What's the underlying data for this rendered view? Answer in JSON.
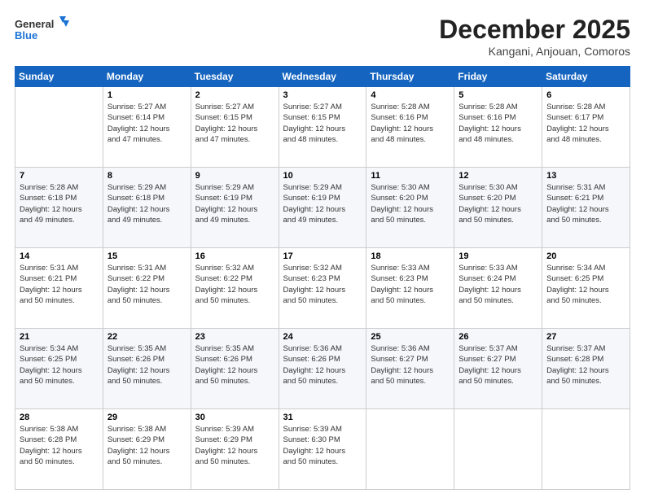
{
  "logo": {
    "line1": "General",
    "line2": "Blue"
  },
  "header": {
    "month": "December 2025",
    "location": "Kangani, Anjouan, Comoros"
  },
  "weekdays": [
    "Sunday",
    "Monday",
    "Tuesday",
    "Wednesday",
    "Thursday",
    "Friday",
    "Saturday"
  ],
  "weeks": [
    [
      {
        "day": "",
        "info": ""
      },
      {
        "day": "1",
        "info": "Sunrise: 5:27 AM\nSunset: 6:14 PM\nDaylight: 12 hours\nand 47 minutes."
      },
      {
        "day": "2",
        "info": "Sunrise: 5:27 AM\nSunset: 6:15 PM\nDaylight: 12 hours\nand 47 minutes."
      },
      {
        "day": "3",
        "info": "Sunrise: 5:27 AM\nSunset: 6:15 PM\nDaylight: 12 hours\nand 48 minutes."
      },
      {
        "day": "4",
        "info": "Sunrise: 5:28 AM\nSunset: 6:16 PM\nDaylight: 12 hours\nand 48 minutes."
      },
      {
        "day": "5",
        "info": "Sunrise: 5:28 AM\nSunset: 6:16 PM\nDaylight: 12 hours\nand 48 minutes."
      },
      {
        "day": "6",
        "info": "Sunrise: 5:28 AM\nSunset: 6:17 PM\nDaylight: 12 hours\nand 48 minutes."
      }
    ],
    [
      {
        "day": "7",
        "info": "Sunrise: 5:28 AM\nSunset: 6:18 PM\nDaylight: 12 hours\nand 49 minutes."
      },
      {
        "day": "8",
        "info": "Sunrise: 5:29 AM\nSunset: 6:18 PM\nDaylight: 12 hours\nand 49 minutes."
      },
      {
        "day": "9",
        "info": "Sunrise: 5:29 AM\nSunset: 6:19 PM\nDaylight: 12 hours\nand 49 minutes."
      },
      {
        "day": "10",
        "info": "Sunrise: 5:29 AM\nSunset: 6:19 PM\nDaylight: 12 hours\nand 49 minutes."
      },
      {
        "day": "11",
        "info": "Sunrise: 5:30 AM\nSunset: 6:20 PM\nDaylight: 12 hours\nand 50 minutes."
      },
      {
        "day": "12",
        "info": "Sunrise: 5:30 AM\nSunset: 6:20 PM\nDaylight: 12 hours\nand 50 minutes."
      },
      {
        "day": "13",
        "info": "Sunrise: 5:31 AM\nSunset: 6:21 PM\nDaylight: 12 hours\nand 50 minutes."
      }
    ],
    [
      {
        "day": "14",
        "info": "Sunrise: 5:31 AM\nSunset: 6:21 PM\nDaylight: 12 hours\nand 50 minutes."
      },
      {
        "day": "15",
        "info": "Sunrise: 5:31 AM\nSunset: 6:22 PM\nDaylight: 12 hours\nand 50 minutes."
      },
      {
        "day": "16",
        "info": "Sunrise: 5:32 AM\nSunset: 6:22 PM\nDaylight: 12 hours\nand 50 minutes."
      },
      {
        "day": "17",
        "info": "Sunrise: 5:32 AM\nSunset: 6:23 PM\nDaylight: 12 hours\nand 50 minutes."
      },
      {
        "day": "18",
        "info": "Sunrise: 5:33 AM\nSunset: 6:23 PM\nDaylight: 12 hours\nand 50 minutes."
      },
      {
        "day": "19",
        "info": "Sunrise: 5:33 AM\nSunset: 6:24 PM\nDaylight: 12 hours\nand 50 minutes."
      },
      {
        "day": "20",
        "info": "Sunrise: 5:34 AM\nSunset: 6:25 PM\nDaylight: 12 hours\nand 50 minutes."
      }
    ],
    [
      {
        "day": "21",
        "info": "Sunrise: 5:34 AM\nSunset: 6:25 PM\nDaylight: 12 hours\nand 50 minutes."
      },
      {
        "day": "22",
        "info": "Sunrise: 5:35 AM\nSunset: 6:26 PM\nDaylight: 12 hours\nand 50 minutes."
      },
      {
        "day": "23",
        "info": "Sunrise: 5:35 AM\nSunset: 6:26 PM\nDaylight: 12 hours\nand 50 minutes."
      },
      {
        "day": "24",
        "info": "Sunrise: 5:36 AM\nSunset: 6:26 PM\nDaylight: 12 hours\nand 50 minutes."
      },
      {
        "day": "25",
        "info": "Sunrise: 5:36 AM\nSunset: 6:27 PM\nDaylight: 12 hours\nand 50 minutes."
      },
      {
        "day": "26",
        "info": "Sunrise: 5:37 AM\nSunset: 6:27 PM\nDaylight: 12 hours\nand 50 minutes."
      },
      {
        "day": "27",
        "info": "Sunrise: 5:37 AM\nSunset: 6:28 PM\nDaylight: 12 hours\nand 50 minutes."
      }
    ],
    [
      {
        "day": "28",
        "info": "Sunrise: 5:38 AM\nSunset: 6:28 PM\nDaylight: 12 hours\nand 50 minutes."
      },
      {
        "day": "29",
        "info": "Sunrise: 5:38 AM\nSunset: 6:29 PM\nDaylight: 12 hours\nand 50 minutes."
      },
      {
        "day": "30",
        "info": "Sunrise: 5:39 AM\nSunset: 6:29 PM\nDaylight: 12 hours\nand 50 minutes."
      },
      {
        "day": "31",
        "info": "Sunrise: 5:39 AM\nSunset: 6:30 PM\nDaylight: 12 hours\nand 50 minutes."
      },
      {
        "day": "",
        "info": ""
      },
      {
        "day": "",
        "info": ""
      },
      {
        "day": "",
        "info": ""
      }
    ]
  ]
}
